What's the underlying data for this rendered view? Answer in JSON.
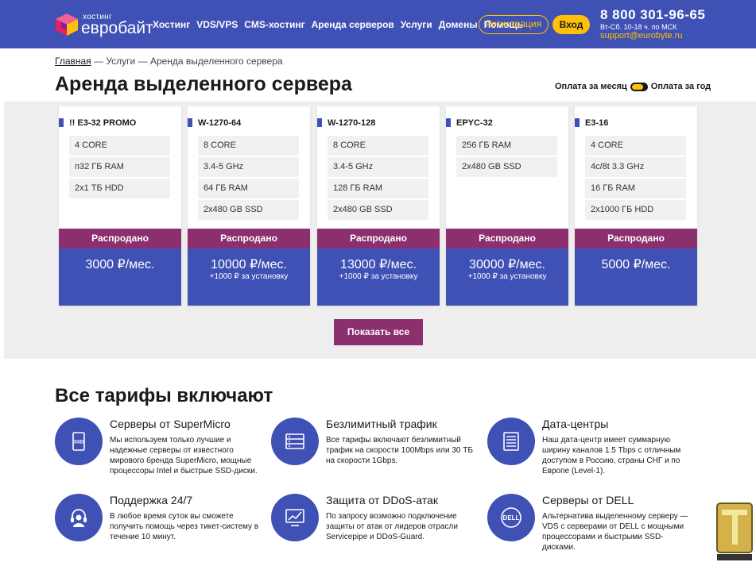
{
  "header": {
    "logo_small": "хостинг",
    "logo_big": "евробайт",
    "nav": [
      "Хостинг",
      "VDS/VPS",
      "CMS-хостинг",
      "Аренда серверов",
      "Услуги",
      "Домены",
      "Помощь"
    ],
    "register_label": "Регистрация",
    "login_label": "Вход",
    "phone": "8 800 301-96-65",
    "hours": "Вт-Сб. 10-18 ч. по МСК",
    "email": "support@eurobyte.ru"
  },
  "breadcrumb": {
    "home": "Главная",
    "sep1": " — ",
    "services": "Услуги",
    "sep2": " — ",
    "current": "Аренда выделенного сервера"
  },
  "page_title": "Аренда выделенного сервера",
  "billing": {
    "monthly": "Оплата за месяц",
    "yearly": "Оплата за год"
  },
  "tariffs": [
    {
      "name": "!! E3-32 PROMO",
      "specs": [
        "4 CORE",
        "п32 ГБ RAM",
        "2x1 ТБ HDD"
      ],
      "status": "Распродано",
      "price": "3000 ₽/мес.",
      "setup": ""
    },
    {
      "name": "W-1270-64",
      "specs": [
        "8 CORE",
        "3.4-5 GHz",
        "64 ГБ RAM",
        "2x480 GB SSD"
      ],
      "status": "Распродано",
      "price": "10000 ₽/мес.",
      "setup": "+1000 ₽ за установку"
    },
    {
      "name": "W-1270-128",
      "specs": [
        "8 CORE",
        "3.4-5 GHz",
        "128 ГБ RAM",
        "2x480 GB SSD"
      ],
      "status": "Распродано",
      "price": "13000 ₽/мес.",
      "setup": "+1000 ₽ за установку"
    },
    {
      "name": "EPYC-32",
      "specs": [
        "256 ГБ RAM",
        "2x480 GB SSD"
      ],
      "status": "Распродано",
      "price": "30000 ₽/мес.",
      "setup": "+1000 ₽ за установку"
    },
    {
      "name": "E3-16",
      "specs": [
        "4 CORE",
        "4c/8t 3.3 GHz",
        "16 ГБ RAM",
        "2x1000 ГБ HDD"
      ],
      "status": "Распродано",
      "price": "5000 ₽/мес.",
      "setup": ""
    }
  ],
  "show_all_label": "Показать все",
  "features_title": "Все тарифы включают",
  "features": [
    {
      "icon": "ssd-icon",
      "title": "Серверы от SuperMicro",
      "text": "Мы используем только лучшие и надежные серверы от известного мирового бренда SuperMicro, мощные процессоры Intel и быстрые SSD-диски."
    },
    {
      "icon": "traffic-icon",
      "title": "Безлимитный трафик",
      "text": "Все тарифы включают безлимитный трафик на скорости 100Mbps или 30 ТБ на скорости 1Gbps."
    },
    {
      "icon": "datacenter-icon",
      "title": "Дата-центры",
      "text": "Наш дата-центр имеет суммарную ширину каналов 1.5 Tbps с отличным доступом в Россию, страны СНГ и по Европе (Level-1)."
    },
    {
      "icon": "support-headset-icon",
      "title": "Поддержка 24/7",
      "text": "В любое время суток вы сможете получить помощь через тикет-систему в течение 10 минут."
    },
    {
      "icon": "ddos-chart-icon",
      "title": "Защита от DDoS-атак",
      "text": "По запросу возможно подключение защиты от атак от лидеров отрасли Servicepipe и DDoS-Guard."
    },
    {
      "icon": "dell-logo-icon",
      "title": "Серверы от DELL",
      "text": "Альтернатива выделенному серверу — VDS с серверами от DELL с мощными процессорами и быстрыми SSD-дисками."
    }
  ],
  "colors": {
    "brand_blue": "#3f51b5",
    "accent_yellow": "#ffc107",
    "sold_purple": "#8b2f6e"
  }
}
